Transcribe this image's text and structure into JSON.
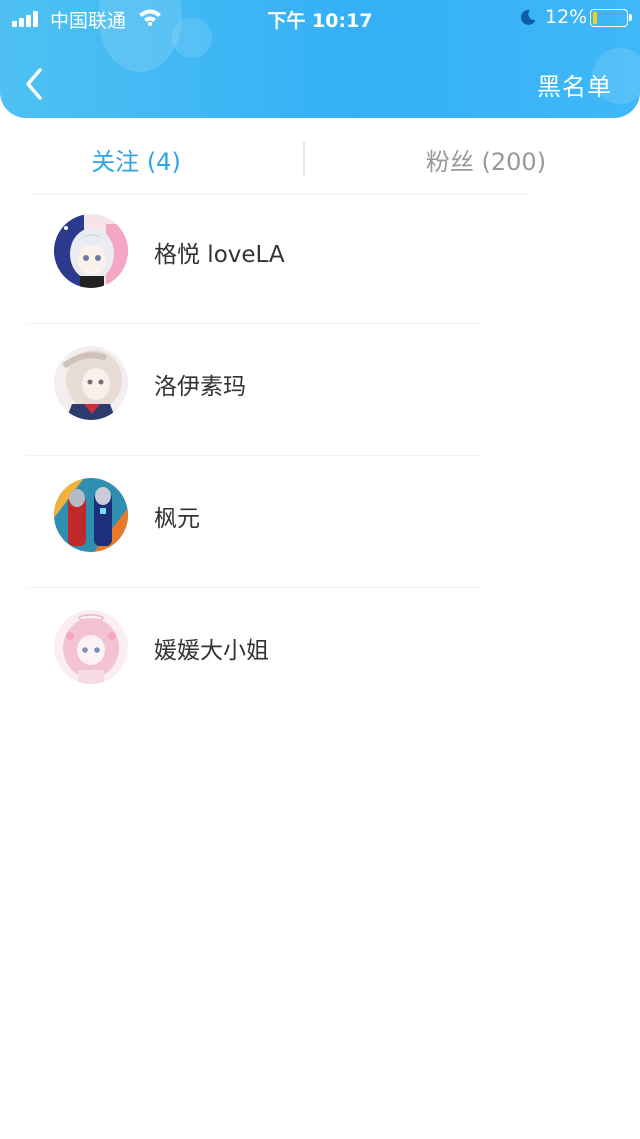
{
  "status_bar": {
    "carrier": "中国联通",
    "time": "下午 10:17",
    "battery_percent": "12%",
    "battery_level": 0.12,
    "icons": [
      "signal-icon",
      "wifi-icon",
      "moon-icon",
      "battery-icon"
    ]
  },
  "nav": {
    "back_icon": "chevron-left-icon",
    "right_label": "黑名单"
  },
  "tabs": {
    "following": "关注 (4)",
    "fans": "粉丝 (200)",
    "active": "following"
  },
  "users": [
    {
      "name": "格悦 loveLA"
    },
    {
      "name": "洛伊素玛"
    },
    {
      "name": "枫元"
    },
    {
      "name": "媛媛大小姐"
    }
  ],
  "colors": {
    "header_gradient_start": "#4ec1f2",
    "header_gradient_end": "#35b0f6",
    "active_tab": "#2fa5e6",
    "inactive_tab": "#999999",
    "battery_low": "#f2d31c"
  }
}
